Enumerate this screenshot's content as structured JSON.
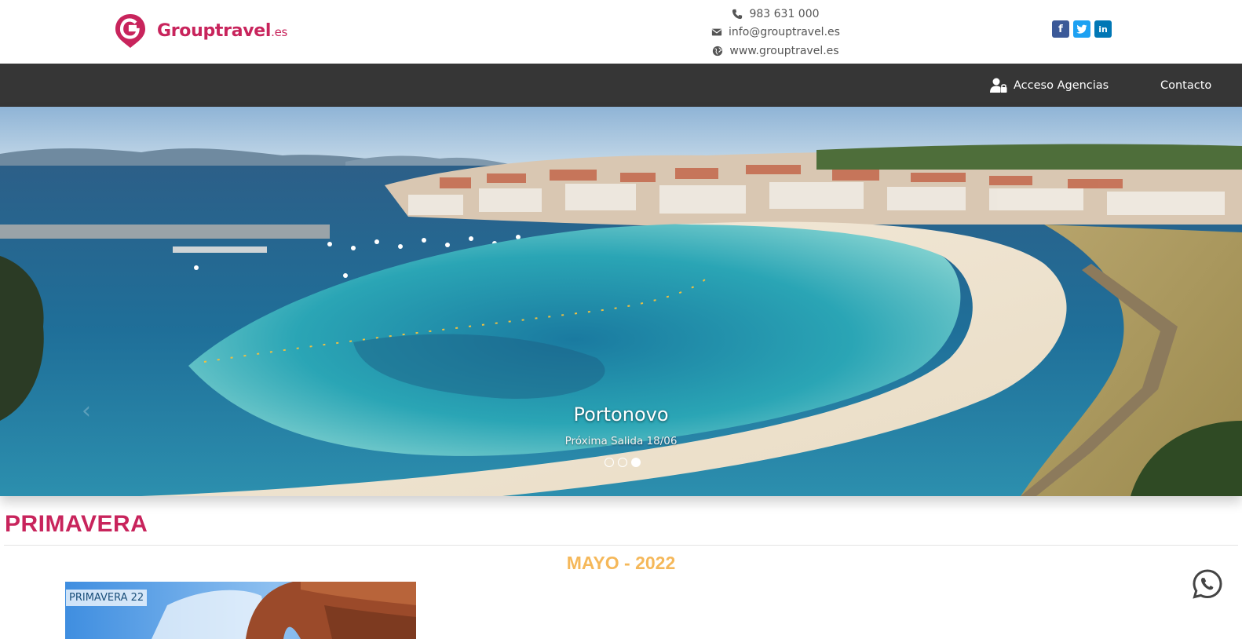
{
  "brand": {
    "name": "Grouptravel",
    "tld": ".es",
    "color": "#c8245c"
  },
  "contact": {
    "phone": "983 631 000",
    "email": "info@grouptravel.es",
    "website": "www.grouptravel.es"
  },
  "social": [
    {
      "name": "facebook",
      "glyph": "f",
      "color": "#3b5998"
    },
    {
      "name": "twitter",
      "glyph": "t",
      "color": "#1da1f2"
    },
    {
      "name": "linkedin",
      "glyph": "in",
      "color": "#0077b5"
    }
  ],
  "nav": {
    "agencias_label": "Acceso Agencias",
    "contacto_label": "Contacto"
  },
  "hero": {
    "title": "Portonovo",
    "subtitle": "Próxima Salida 18/06",
    "slides": 3,
    "active_slide": 3
  },
  "section": {
    "title": "PRIMAVERA",
    "month": "MAYO - 2022"
  },
  "trip": {
    "badge": "PRIMAVERA 22"
  },
  "icons": {
    "phone": "phone-icon",
    "email": "envelope-icon",
    "web": "globe-icon",
    "agencias": "users-lock-icon",
    "whatsapp": "whatsapp-icon"
  }
}
